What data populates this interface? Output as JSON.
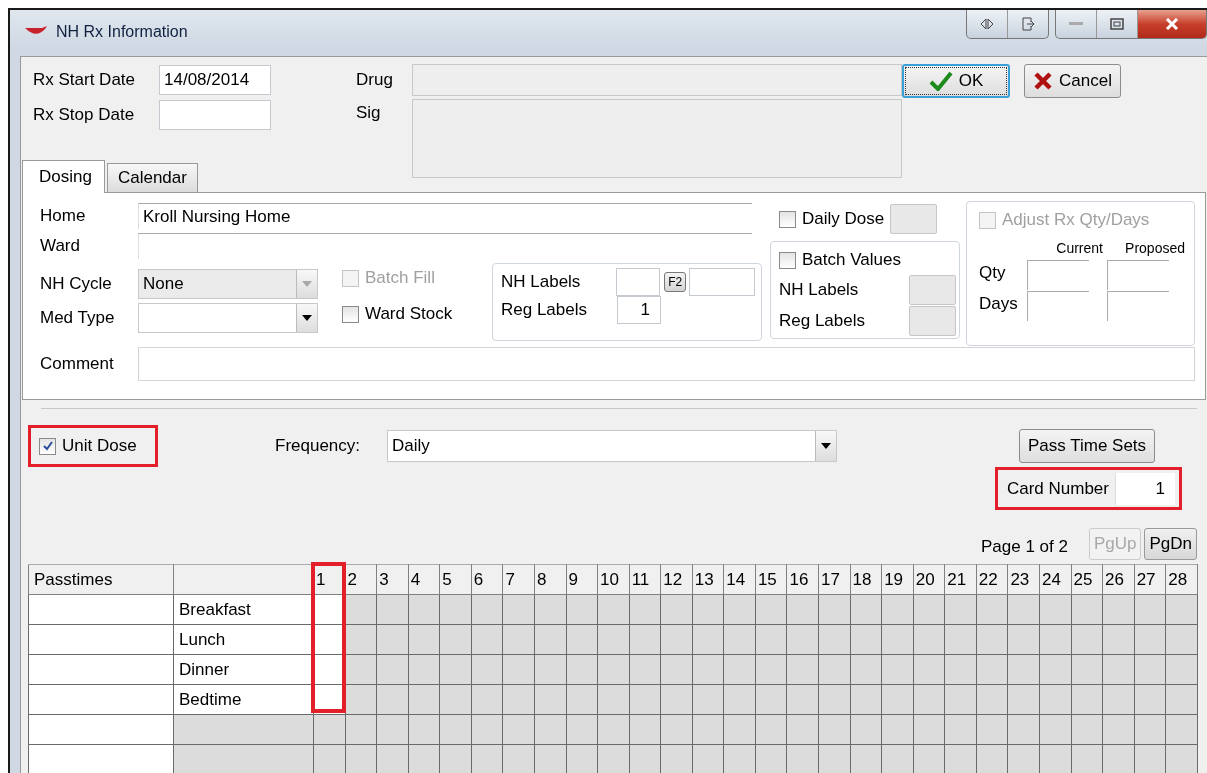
{
  "window": {
    "title": "NH Rx Information"
  },
  "rx_start_date": {
    "label": "Rx Start Date",
    "value": "14/08/2014"
  },
  "rx_stop_date": {
    "label": "Rx Stop Date"
  },
  "drug": {
    "label": "Drug"
  },
  "sig": {
    "label": "Sig"
  },
  "buttons": [
    {
      "label": "OK",
      "kind": "ok",
      "focused": true
    },
    {
      "label": "Cancel",
      "kind": "cancel",
      "focused": false
    }
  ],
  "tabs": [
    {
      "label": "Dosing",
      "selected": true
    },
    {
      "label": "Calendar",
      "selected": false
    }
  ],
  "home": {
    "label": "Home",
    "value": "Kroll Nursing Home"
  },
  "ward": {
    "label": "Ward"
  },
  "nh_cycle": {
    "label": "NH Cycle",
    "value": "None",
    "disabled": true
  },
  "med_type": {
    "label": "Med Type",
    "disabled": false
  },
  "batch_fill": {
    "label": "Batch Fill",
    "checked": false,
    "disabled": true
  },
  "ward_stock": {
    "label": "Ward Stock",
    "checked": false,
    "disabled": false
  },
  "labels_group": {
    "nh_labels": "NH Labels",
    "reg_labels": "Reg Labels",
    "reg_value": "1",
    "key": "F2"
  },
  "daily_dose": {
    "label": "Daily Dose",
    "checked": false
  },
  "batch_values": {
    "label": "Batch Values",
    "checked": false,
    "nh_labels": "NH Labels",
    "reg_labels": "Reg Labels"
  },
  "adjust": {
    "label": "Adjust Rx Qty/Days",
    "checked": false,
    "disabled": true,
    "columns": [
      "Current",
      "Proposed"
    ],
    "rows": [
      "Qty",
      "Days"
    ]
  },
  "comment": {
    "label": "Comment"
  },
  "unit_dose": {
    "label": "Unit Dose",
    "checked": true,
    "highlighted": true
  },
  "frequency": {
    "label": "Frequency:",
    "value": "Daily"
  },
  "pass_time_sets": {
    "label": "Pass Time Sets"
  },
  "card_number": {
    "label": "Card Number",
    "value": "1",
    "highlighted": true
  },
  "pager": {
    "text": "Page 1 of 2",
    "buttons": [
      {
        "label": "PgUp",
        "disabled": true
      },
      {
        "label": "PgDn",
        "disabled": false
      }
    ]
  },
  "grid": {
    "heading": "Passtimes",
    "rows": [
      {
        "label": "Breakfast",
        "active": true
      },
      {
        "label": "Lunch",
        "active": true
      },
      {
        "label": "Dinner",
        "active": true
      },
      {
        "label": "Bedtime",
        "active": true
      },
      {
        "active": false
      },
      {
        "active": false
      }
    ],
    "days": [
      {
        "label": "1",
        "active": true,
        "highlighted": true
      },
      {
        "label": "2",
        "active": false,
        "highlighted": false
      },
      {
        "label": "3",
        "active": false,
        "highlighted": false
      },
      {
        "label": "4",
        "active": false,
        "highlighted": false
      },
      {
        "label": "5",
        "active": false,
        "highlighted": false
      },
      {
        "label": "6",
        "active": false,
        "highlighted": false
      },
      {
        "label": "7",
        "active": false,
        "highlighted": false
      },
      {
        "label": "8",
        "active": false,
        "highlighted": false
      },
      {
        "label": "9",
        "active": false,
        "highlighted": false
      },
      {
        "label": "10",
        "active": false,
        "highlighted": false
      },
      {
        "label": "11",
        "active": false,
        "highlighted": false
      },
      {
        "label": "12",
        "active": false,
        "highlighted": false
      },
      {
        "label": "13",
        "active": false,
        "highlighted": false
      },
      {
        "label": "14",
        "active": false,
        "highlighted": false
      },
      {
        "label": "15",
        "active": false,
        "highlighted": false
      },
      {
        "label": "16",
        "active": false,
        "highlighted": false
      },
      {
        "label": "17",
        "active": false,
        "highlighted": false
      },
      {
        "label": "18",
        "active": false,
        "highlighted": false
      },
      {
        "label": "19",
        "active": false,
        "highlighted": false
      },
      {
        "label": "20",
        "active": false,
        "highlighted": false
      },
      {
        "label": "21",
        "active": false,
        "highlighted": false
      },
      {
        "label": "22",
        "active": false,
        "highlighted": false
      },
      {
        "label": "23",
        "active": false,
        "highlighted": false
      },
      {
        "label": "24",
        "active": false,
        "highlighted": false
      },
      {
        "label": "25",
        "active": false,
        "highlighted": false
      },
      {
        "label": "26",
        "active": false,
        "highlighted": false
      },
      {
        "label": "27",
        "active": false,
        "highlighted": false
      },
      {
        "label": "28",
        "active": false,
        "highlighted": false
      }
    ]
  }
}
